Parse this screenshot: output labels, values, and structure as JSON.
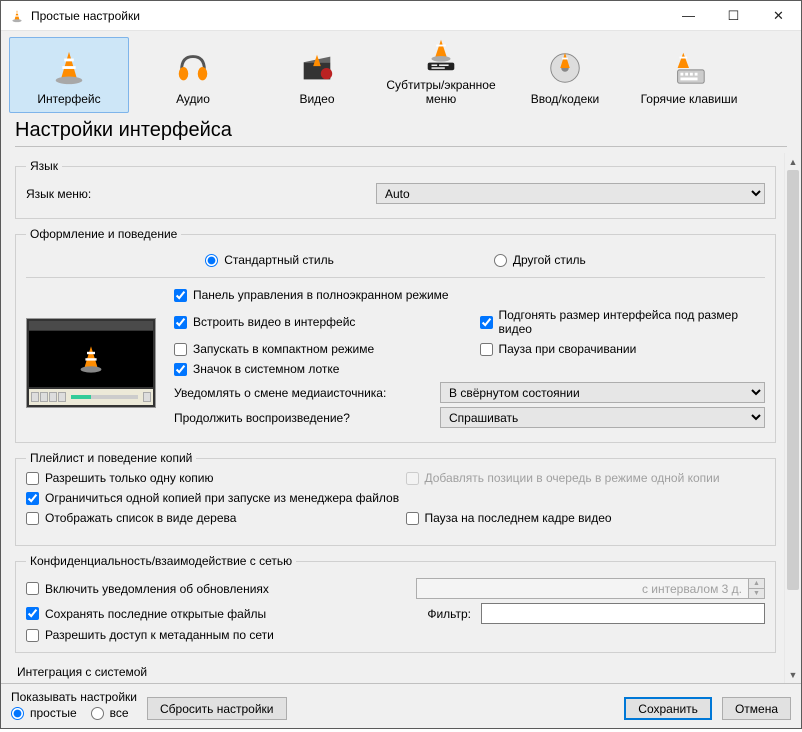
{
  "titlebar": {
    "title": "Простые настройки"
  },
  "categories": [
    {
      "id": "interface",
      "label": "Интерфейс",
      "selected": true
    },
    {
      "id": "audio",
      "label": "Аудио",
      "selected": false
    },
    {
      "id": "video",
      "label": "Видео",
      "selected": false
    },
    {
      "id": "subtitles",
      "label": "Субтитры/экранное меню",
      "selected": false
    },
    {
      "id": "input",
      "label": "Ввод/кодеки",
      "selected": false
    },
    {
      "id": "hotkeys",
      "label": "Горячие клавиши",
      "selected": false
    }
  ],
  "main_title": "Настройки интерфейса",
  "language": {
    "legend": "Язык",
    "menu_label": "Язык меню:",
    "value": "Auto"
  },
  "look": {
    "legend": "Оформление и поведение",
    "style_radio": {
      "native": "Стандартный стиль",
      "custom": "Другой стиль",
      "selected": "native"
    },
    "checks": {
      "fs_controller": {
        "label": "Панель управления в полноэкранном режиме",
        "checked": true
      },
      "embed_video": {
        "label": "Встроить видео в интерфейс",
        "checked": true
      },
      "resize_iface": {
        "label": "Подгонять размер интерфейса под размер видео",
        "checked": true
      },
      "minimal_view": {
        "label": "Запускать в компактном режиме",
        "checked": false
      },
      "pause_minimize": {
        "label": "Пауза при сворачивании",
        "checked": false
      },
      "systray": {
        "label": "Значок в системном лотке",
        "checked": true
      }
    },
    "notify_label": "Уведомлять о смене медиаисточника:",
    "notify_value": "В свёрнутом состоянии",
    "continue_label": "Продолжить воспроизведение?",
    "continue_value": "Спрашивать"
  },
  "playlist": {
    "legend": "Плейлист и поведение копий",
    "allow_one": {
      "label": "Разрешить только одну копию",
      "checked": false
    },
    "enqueue": {
      "label": "Добавлять позиции в очередь в режиме одной копии",
      "checked": false,
      "disabled": true
    },
    "one_from_file": {
      "label": "Ограничиться одной копией при запуске из менеджера файлов",
      "checked": true
    },
    "tree_view": {
      "label": "Отображать список в виде дерева",
      "checked": false
    },
    "pause_last": {
      "label": "Пауза на последнем кадре видео",
      "checked": false
    }
  },
  "privacy": {
    "legend": "Конфиденциальность/взаимодействие с сетью",
    "updates": {
      "label": "Включить уведомления об обновлениях",
      "checked": false
    },
    "updates_interval": "с интервалом 3 д.",
    "save_recent": {
      "label": "Сохранять последние открытые файлы",
      "checked": true
    },
    "filter_label": "Фильтр:",
    "filter_value": "",
    "meta_net": {
      "label": "Разрешить доступ к метаданным по сети",
      "checked": false
    }
  },
  "os_integration": {
    "legend": "Интеграция с системой"
  },
  "footer": {
    "show_label": "Показывать настройки",
    "simple": "простые",
    "all": "все",
    "selected": "simple",
    "reset": "Сбросить настройки",
    "save": "Сохранить",
    "cancel": "Отмена"
  }
}
